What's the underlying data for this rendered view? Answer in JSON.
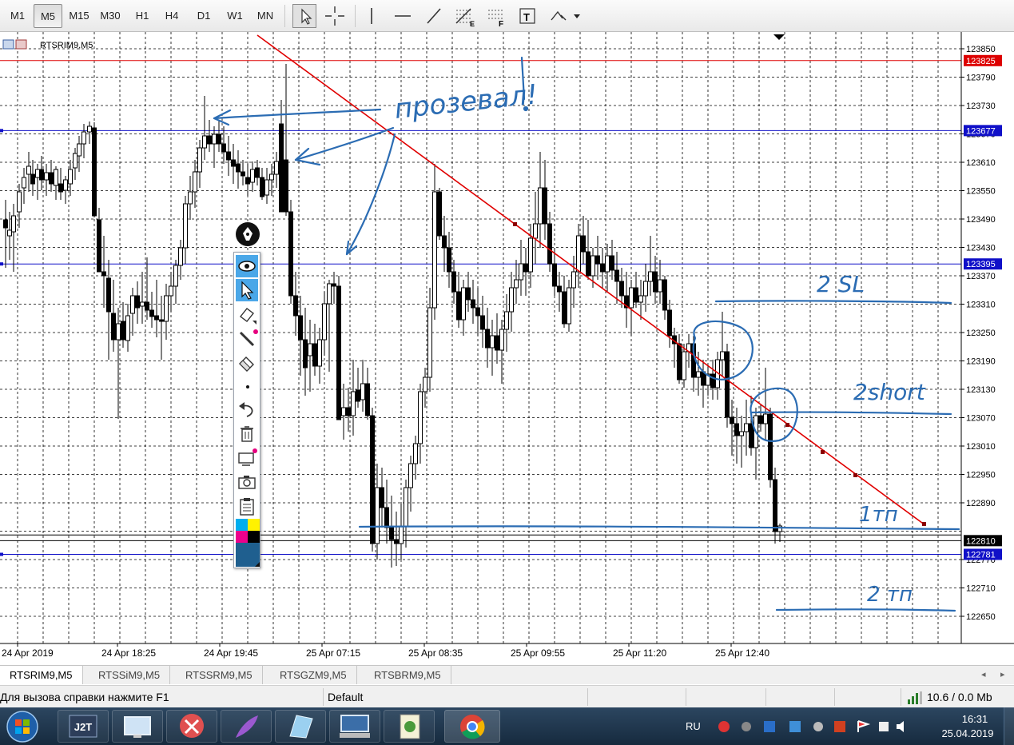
{
  "toolbar": {
    "timeframes": [
      "M1",
      "M5",
      "M15",
      "M30",
      "H1",
      "H4",
      "D1",
      "W1",
      "MN"
    ],
    "active_timeframe": "M5",
    "tools": [
      "cursor-icon",
      "crosshair-icon",
      "vertical-line-icon",
      "horizontal-line-icon",
      "trendline-icon",
      "fibonacci-icon",
      "text-label-icon",
      "shapes-dropdown-icon"
    ]
  },
  "chart": {
    "symbol_title": "RTSRIM9,M5",
    "price_labels": [
      "123850",
      "123790",
      "123730",
      "123670",
      "123610",
      "123550",
      "123490",
      "123430",
      "123370",
      "123310",
      "123250",
      "123190",
      "123130",
      "123070",
      "123010",
      "122950",
      "122890",
      "122770",
      "122710",
      "122650"
    ],
    "price_tags": [
      {
        "value": "123825",
        "color": "#dd0000"
      },
      {
        "value": "123677",
        "color": "#1010c8"
      },
      {
        "value": "123395",
        "color": "#1010c8"
      },
      {
        "value": "122810",
        "color": "#000000"
      },
      {
        "value": "122781",
        "color": "#1010c8"
      }
    ],
    "time_labels": [
      "24 Apr 2019",
      "24 Apr 18:25",
      "24 Apr 19:45",
      "25 Apr 07:15",
      "25 Apr 08:35",
      "25 Apr 09:55",
      "25 Apr 11:20",
      "25 Apr 12:40"
    ],
    "annotations": {
      "prozeval": "прозевал!",
      "sl2": "2 SL",
      "short2": "2short",
      "tp1": "1тп",
      "tp2": "2 тп"
    },
    "colors": {
      "background": "#ffffff",
      "grid": "#000000",
      "trendline": "#e00000",
      "level_blue": "#1010c8",
      "ink": "#2b6cb3"
    }
  },
  "palette": {
    "tools": [
      "eye-icon",
      "pointer-icon",
      "marker-icon",
      "pen-icon",
      "eraser-icon",
      "dot-icon",
      "undo-icon",
      "trash-icon",
      "screen-capture-icon",
      "camera-icon",
      "clipboard-icon"
    ],
    "swatches": [
      "#00aeef",
      "#fff200",
      "#ec008c",
      "#000000"
    ],
    "current_color": "#1f5f8f"
  },
  "tabs": [
    "RTSRIM9,M5",
    "RTSSiM9,M5",
    "RTSSRM9,M5",
    "RTSGZM9,M5",
    "RTSBRM9,M5"
  ],
  "status": {
    "help": "Для вызова справки нажмите F1",
    "profile": "Default",
    "traffic": "10.6 / 0.0 Mb"
  },
  "taskbar": {
    "apps": [
      "start-orb",
      "j2t-app",
      "monitor-app",
      "scissors-app",
      "feather-app",
      "notes-app",
      "terminal-app",
      "script-app",
      "chrome-app"
    ],
    "j2t_label": "J2T",
    "language": "RU",
    "time": "16:31",
    "date": "25.04.2019"
  }
}
